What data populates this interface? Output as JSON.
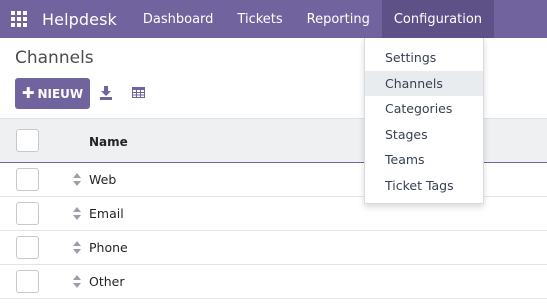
{
  "navbar": {
    "app_name": "Helpdesk",
    "menu": [
      "Dashboard",
      "Tickets",
      "Reporting",
      "Configuration"
    ],
    "active_menu": "Configuration",
    "color": "#71639e"
  },
  "breadcrumb": "Channels",
  "toolbar": {
    "new_label": "NIEUW",
    "new_icon": "plus",
    "download_icon": "download-icon",
    "view_icon": "table-icon"
  },
  "table": {
    "columns": [
      "Name"
    ],
    "rows": [
      "Web",
      "Email",
      "Phone",
      "Other"
    ]
  },
  "dropdown": {
    "items": [
      "Settings",
      "Channels",
      "Categories",
      "Stages",
      "Teams",
      "Ticket Tags"
    ],
    "highlighted": "Channels"
  }
}
